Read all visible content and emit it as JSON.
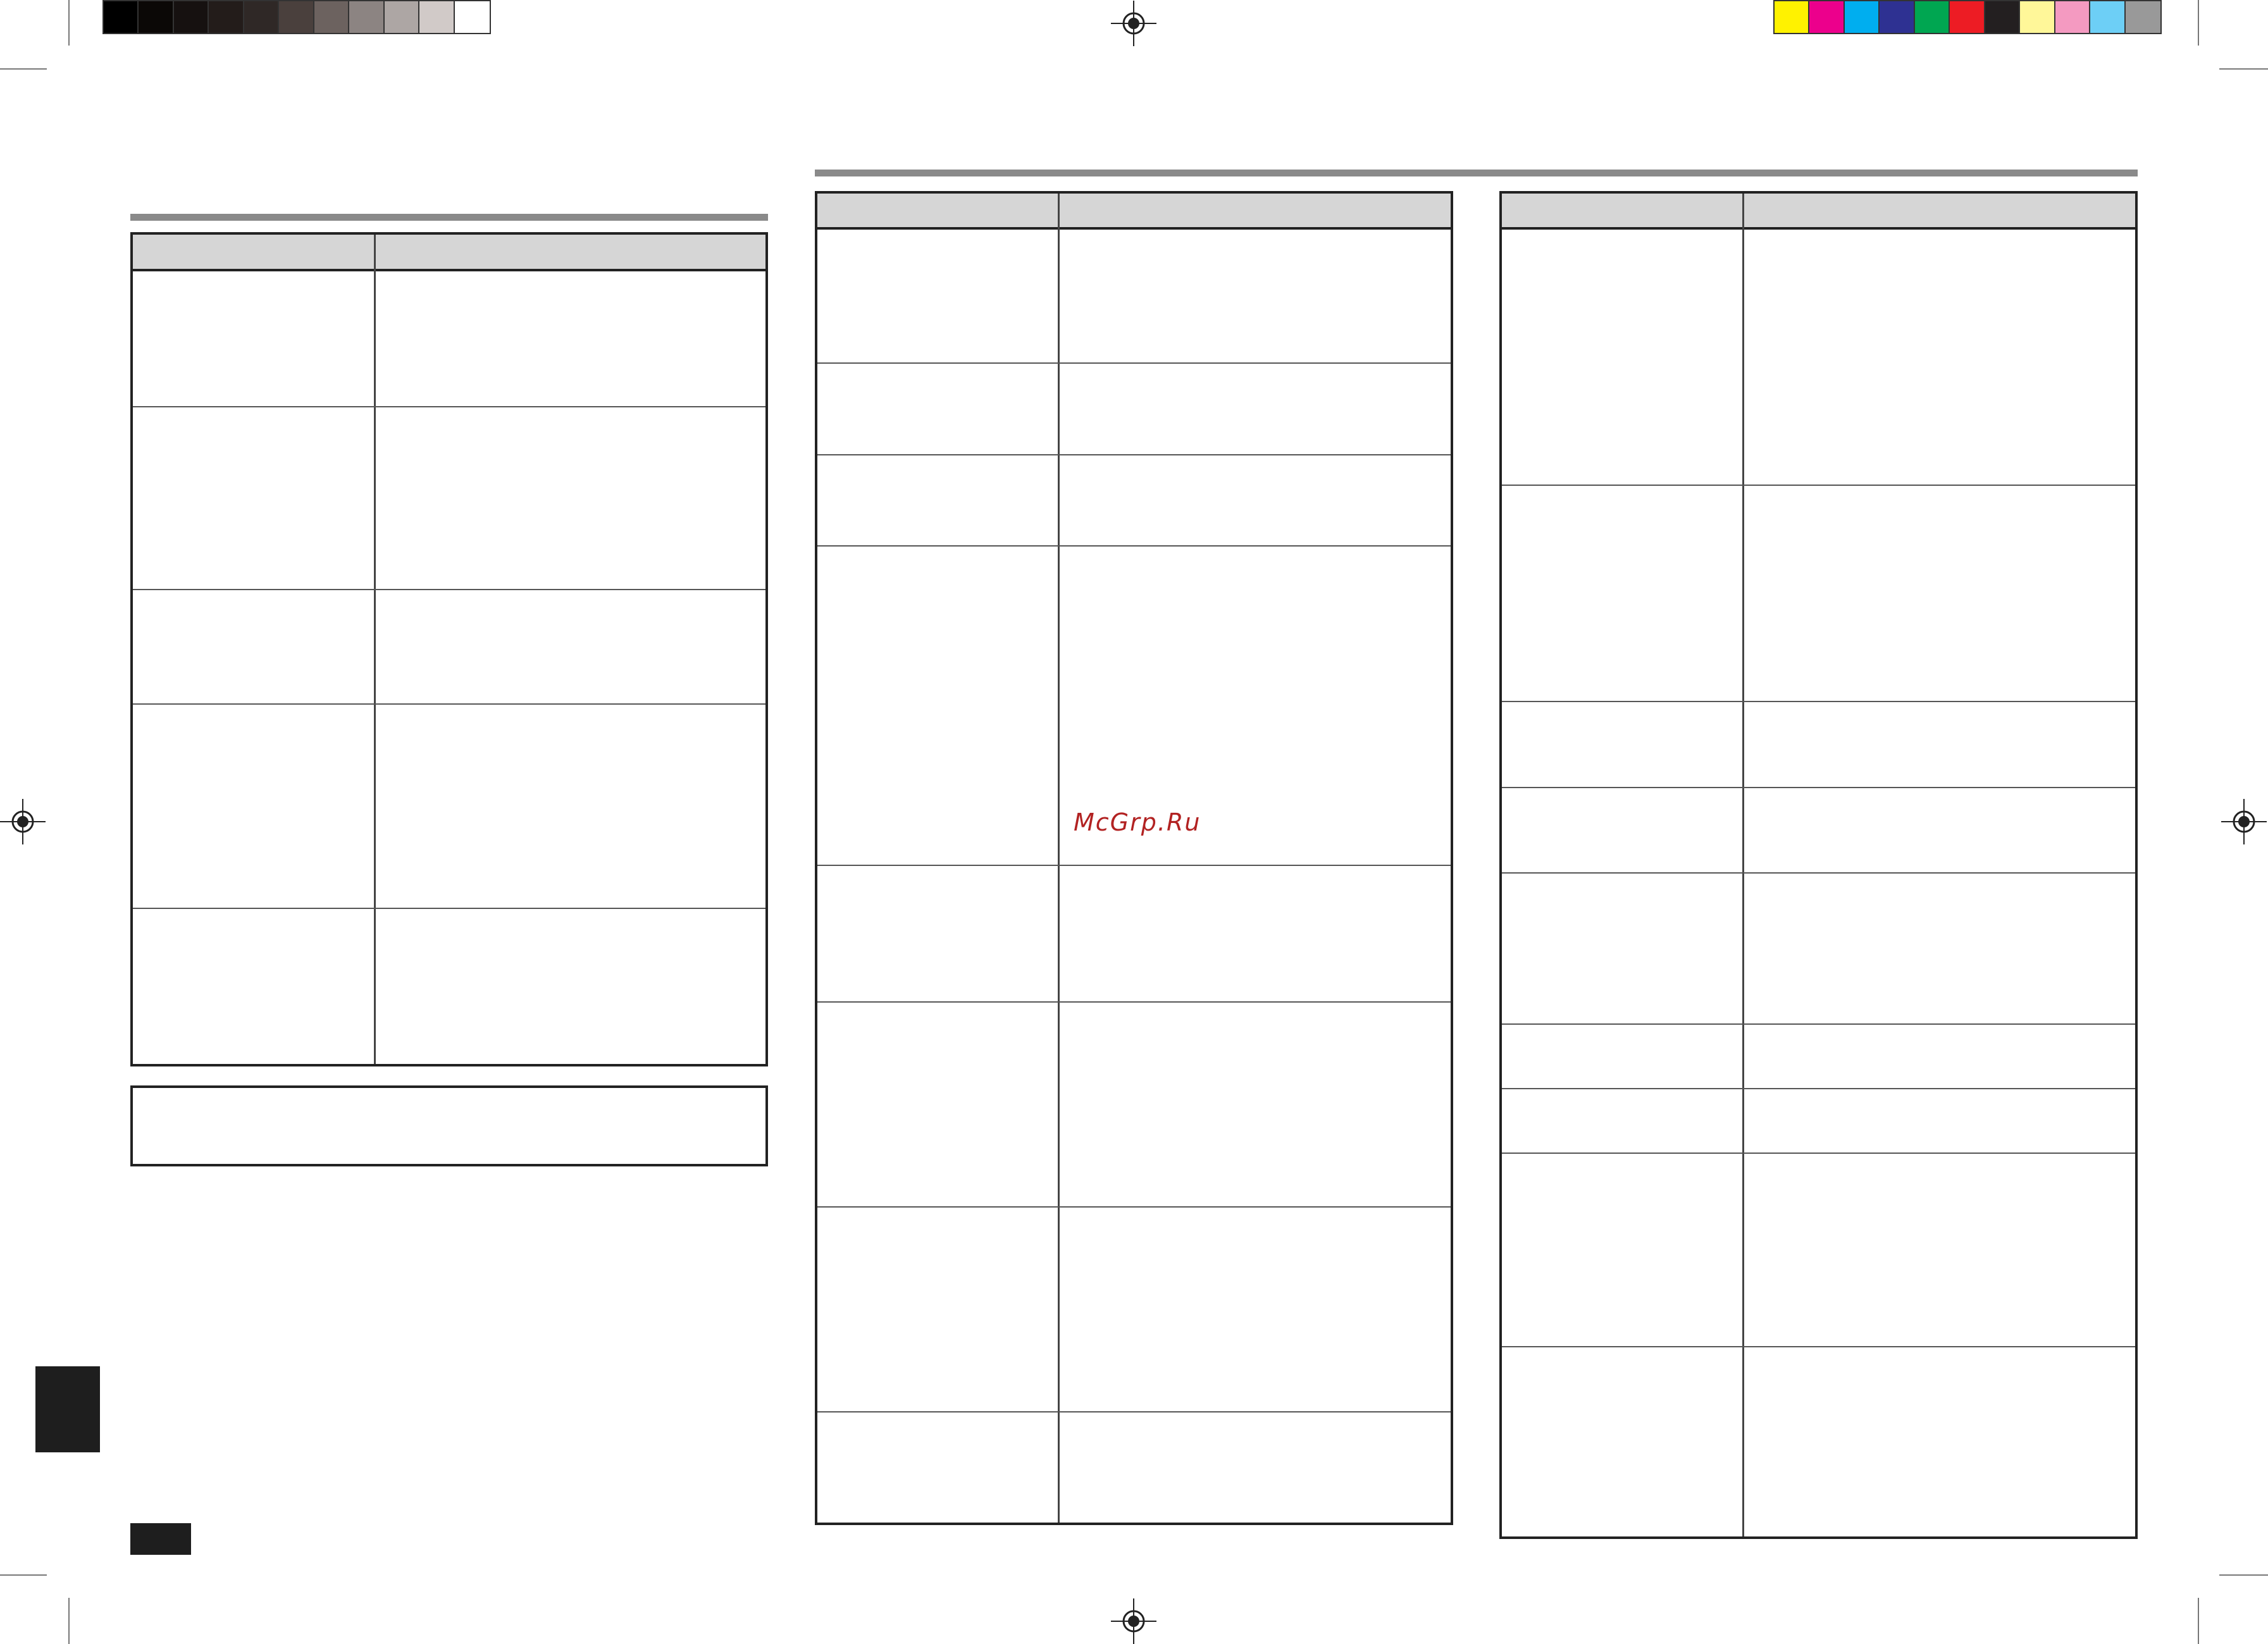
{
  "page": {
    "watermark": "McGrp.Ru"
  },
  "print_marks": {
    "grayscale_swatches": [
      "#000000",
      "#0b0806",
      "#161110",
      "#231c1a",
      "#2f2826",
      "#4a403d",
      "#6c625f",
      "#8c8482",
      "#ada6a4",
      "#d1cac8",
      "#ffffff"
    ],
    "color_swatches": [
      "#fff200",
      "#ec008c",
      "#00aeef",
      "#2e3192",
      "#00a651",
      "#ed1c24",
      "#231f20",
      "#fff799",
      "#f49ac1",
      "#6dcff6",
      "#999999"
    ]
  },
  "left_table": {
    "header": [
      "",
      ""
    ],
    "rows": [
      [
        "",
        ""
      ],
      [
        "",
        ""
      ],
      [
        "",
        ""
      ],
      [
        "",
        ""
      ],
      [
        "",
        ""
      ]
    ],
    "note": ""
  },
  "middle_table": {
    "header": [
      "",
      ""
    ],
    "rows": [
      [
        "",
        ""
      ],
      [
        "",
        ""
      ],
      [
        "",
        ""
      ],
      [
        "",
        ""
      ],
      [
        "",
        ""
      ],
      [
        "",
        ""
      ],
      [
        "",
        ""
      ],
      [
        "",
        ""
      ]
    ]
  },
  "right_table": {
    "header": [
      "",
      ""
    ],
    "rows": [
      [
        "",
        ""
      ],
      [
        "",
        ""
      ],
      [
        "",
        ""
      ],
      [
        "",
        ""
      ],
      [
        "",
        ""
      ],
      [
        "",
        ""
      ],
      [
        "",
        ""
      ],
      [
        "",
        ""
      ],
      [
        "",
        ""
      ]
    ]
  },
  "page_tab": "",
  "page_number": ""
}
